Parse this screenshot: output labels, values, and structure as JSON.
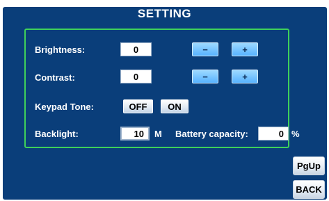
{
  "title": "SETTING",
  "rows": {
    "brightness": {
      "label": "Brightness:",
      "value": "0",
      "minus": "−",
      "plus": "+"
    },
    "contrast": {
      "label": "Contrast:",
      "value": "0",
      "minus": "−",
      "plus": "+"
    },
    "keypad_tone": {
      "label": "Keypad Tone:",
      "off": "OFF",
      "on": "ON"
    },
    "backlight": {
      "label": "Backlight:",
      "value": "10",
      "unit": "M"
    },
    "battery": {
      "label": "Battery capacity:",
      "value": "0",
      "unit": "%"
    }
  },
  "side_buttons": {
    "pgup": "PgUp",
    "back": "BACK"
  },
  "colors": {
    "panel": "#0a3e7a",
    "frame": "#3fd05a",
    "stepper": "#57b2ff"
  }
}
